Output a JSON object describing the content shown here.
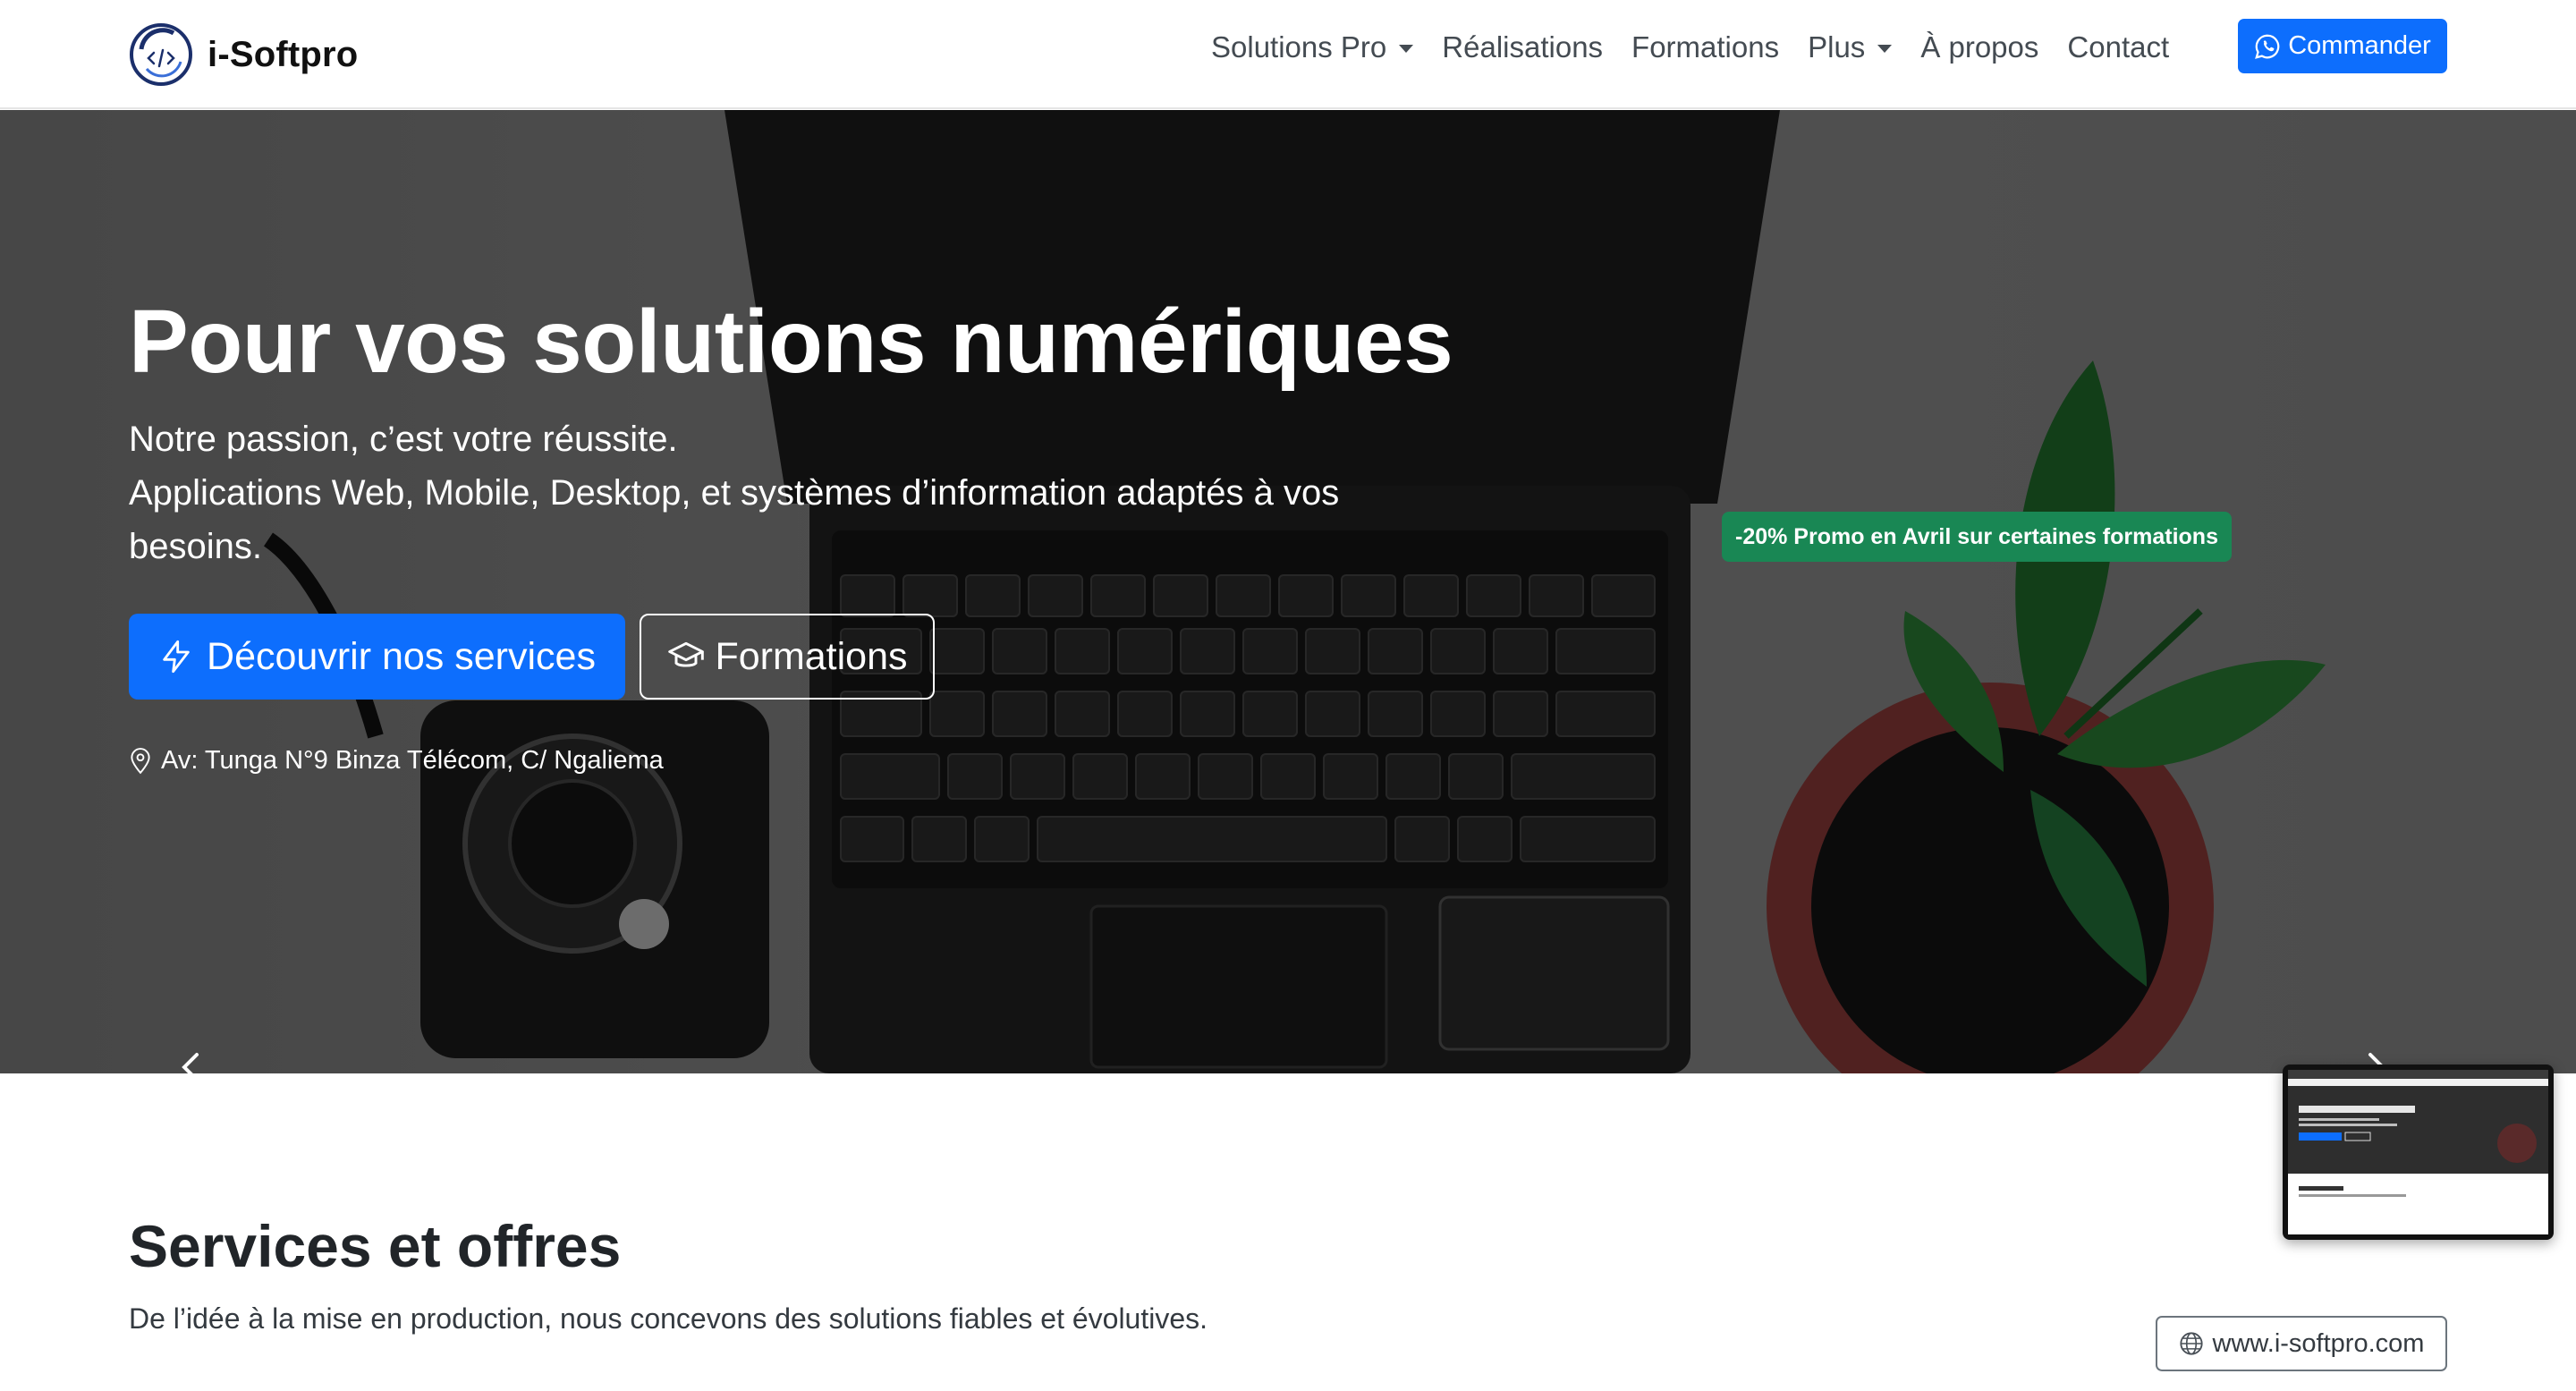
{
  "navbar": {
    "brand_name": "i-Softpro",
    "items": [
      {
        "label": "Solutions Pro",
        "dropdown": true
      },
      {
        "label": "Réalisations",
        "dropdown": false
      },
      {
        "label": "Formations",
        "dropdown": false
      },
      {
        "label": "Plus",
        "dropdown": true
      },
      {
        "label": "À propos",
        "dropdown": false
      },
      {
        "label": "Contact",
        "dropdown": false
      }
    ],
    "order_button": {
      "label": "Commander",
      "icon": "whatsapp-icon"
    }
  },
  "hero": {
    "title": "Pour vos solutions numériques",
    "subtitle_line1": "Notre passion, c’est votre réussite.",
    "subtitle_line2": "Applications Web, Mobile, Desktop, et systèmes d’information adaptés à vos besoins.",
    "primary_button": {
      "label": "Découvrir nos services",
      "icon": "lightning-icon"
    },
    "secondary_button": {
      "label": "Formations",
      "icon": "graduation-cap-icon"
    },
    "address": {
      "label": "Av: Tunga N°9 Binza Télécom, C/ Ngaliema",
      "icon": "map-pin-icon"
    },
    "promo_badge": "-20% Promo en Avril sur certaines formations"
  },
  "services": {
    "title": "Services et offres",
    "description": "De l’idée à la mise en production, nous concevons des solutions fiables et évolutives."
  },
  "url_badge": {
    "label": "www.i-softpro.com",
    "icon": "globe-icon"
  },
  "colors": {
    "primary": "#0d6efd",
    "success": "#198754",
    "nav_text": "#444b52",
    "heading": "#212529"
  }
}
